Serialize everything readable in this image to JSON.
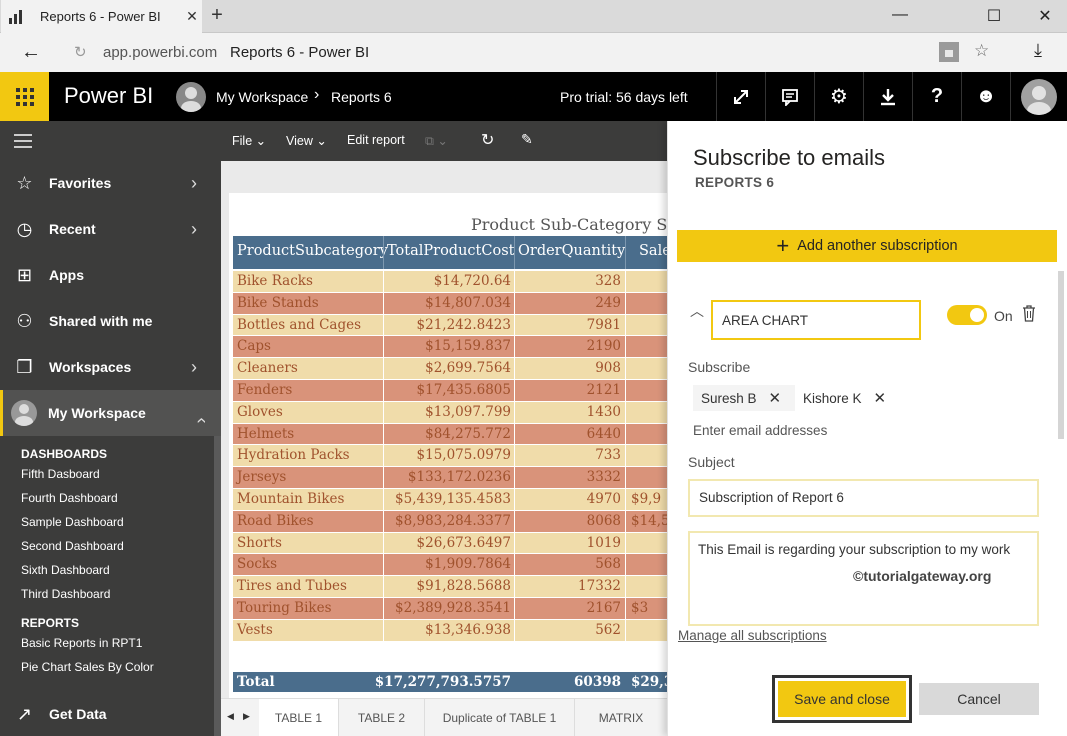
{
  "browser": {
    "tab_title": "Reports 6 - Power BI",
    "url": "app.powerbi.com",
    "page_title": "Reports 6 - Power BI"
  },
  "header": {
    "brand": "Power BI",
    "breadcrumb_workspace": "My Workspace",
    "breadcrumb_report": "Reports 6",
    "trial": "Pro trial: 56 days left",
    "accent": "#f2c811"
  },
  "leftnav": {
    "items": [
      {
        "label": "Favorites",
        "icon": "star-icon"
      },
      {
        "label": "Recent",
        "icon": "clock-icon"
      },
      {
        "label": "Apps",
        "icon": "apps-icon"
      },
      {
        "label": "Shared with me",
        "icon": "shared-icon"
      },
      {
        "label": "Workspaces",
        "icon": "workspaces-icon"
      },
      {
        "label": "My Workspace",
        "icon": "avatar"
      }
    ],
    "dashboards_heading": "DASHBOARDS",
    "dashboards": [
      "Fifth Dasboard",
      "Fourth Dashboard",
      "Sample Dashboard",
      "Second Dashboard",
      "Sixth Dashboard",
      "Third Dashboard"
    ],
    "reports_heading": "REPORTS",
    "reports": [
      "Basic Reports in RPT1",
      "Pie Chart Sales By Color"
    ],
    "get_data": "Get Data"
  },
  "reportbar": {
    "file": "File",
    "view": "View",
    "edit": "Edit report"
  },
  "table": {
    "title": "Product Sub-Category Sa",
    "headers": [
      "ProductSubcategory",
      "TotalProductCost",
      "OrderQuantity",
      "Sale"
    ],
    "rows": [
      [
        "Bike Racks",
        "$14,720.64",
        "328",
        ""
      ],
      [
        "Bike Stands",
        "$14,807.034",
        "249",
        ""
      ],
      [
        "Bottles and Cages",
        "$21,242.8423",
        "7981",
        ""
      ],
      [
        "Caps",
        "$15,159.837",
        "2190",
        ""
      ],
      [
        "Cleaners",
        "$2,699.7564",
        "908",
        ""
      ],
      [
        "Fenders",
        "$17,435.6805",
        "2121",
        ""
      ],
      [
        "Gloves",
        "$13,097.799",
        "1430",
        ""
      ],
      [
        "Helmets",
        "$84,275.772",
        "6440",
        ""
      ],
      [
        "Hydration Packs",
        "$15,075.0979",
        "733",
        ""
      ],
      [
        "Jerseys",
        "$133,172.0236",
        "3332",
        ""
      ],
      [
        "Mountain Bikes",
        "$5,439,135.4583",
        "4970",
        "$9,9"
      ],
      [
        "Road Bikes",
        "$8,983,284.3377",
        "8068",
        "$14,5"
      ],
      [
        "Shorts",
        "$26,673.6497",
        "1019",
        ""
      ],
      [
        "Socks",
        "$1,909.7864",
        "568",
        ""
      ],
      [
        "Tires and Tubes",
        "$91,828.5688",
        "17332",
        ""
      ],
      [
        "Touring Bikes",
        "$2,389,928.3541",
        "2167",
        "$3"
      ],
      [
        "Vests",
        "$13,346.938",
        "562",
        ""
      ]
    ],
    "total": [
      "Total",
      "$17,277,793.5757",
      "60398",
      "$29,3"
    ],
    "row_colors": [
      "#f0dcaa",
      "#d9937a"
    ]
  },
  "pagetabs": [
    "TABLE 1",
    "TABLE 2",
    "Duplicate of TABLE 1",
    "MATRIX"
  ],
  "panel": {
    "title": "Subscribe to emails",
    "subtitle": "REPORTS 6",
    "add_button": "Add another subscription",
    "subscription_name": "AREA CHART",
    "toggle_label": "On",
    "subscribe_label": "Subscribe",
    "recipients": [
      "Suresh B",
      "Kishore K"
    ],
    "email_placeholder": "Enter email addresses",
    "subject_label": "Subject",
    "subject_value": "Subscription of Report 6",
    "message": "This Email is regarding your subscription to my work",
    "watermark": "©tutorialgateway.org",
    "manage_link": "Manage all subscriptions",
    "save": "Save and close",
    "cancel": "Cancel"
  }
}
